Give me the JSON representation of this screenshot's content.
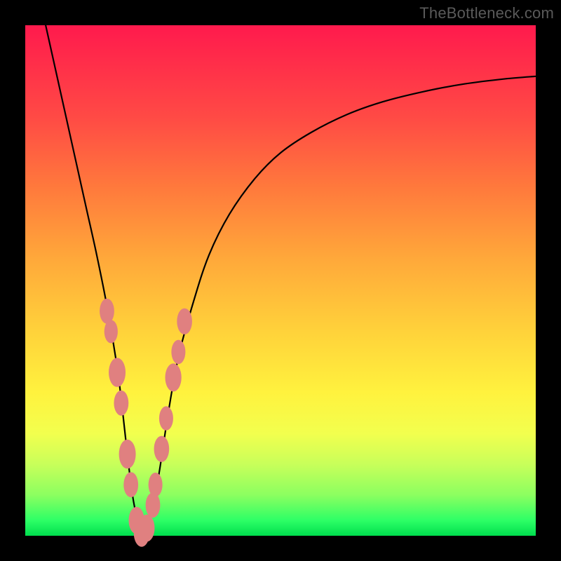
{
  "watermark": "TheBottleneck.com",
  "chart_data": {
    "type": "line",
    "title": "",
    "xlabel": "",
    "ylabel": "",
    "xlim": [
      0,
      100
    ],
    "ylim": [
      0,
      100
    ],
    "grid": false,
    "series": [
      {
        "name": "curve",
        "x": [
          4,
          6,
          8,
          10,
          12,
          14,
          16,
          18,
          19,
          20,
          21,
          22,
          23,
          24,
          26,
          28,
          30,
          33,
          36,
          40,
          45,
          50,
          56,
          63,
          70,
          78,
          86,
          94,
          100
        ],
        "y": [
          100,
          91,
          82,
          73,
          64,
          55,
          45,
          33,
          25,
          16,
          8,
          3,
          0,
          2,
          11,
          24,
          35,
          46,
          55,
          63,
          70,
          75,
          79,
          82.5,
          85,
          87,
          88.5,
          89.5,
          90
        ]
      }
    ],
    "markers": [
      {
        "x": 16.0,
        "y": 44,
        "r": 2.6
      },
      {
        "x": 16.8,
        "y": 40,
        "r": 2.4
      },
      {
        "x": 18.0,
        "y": 32,
        "r": 3.0
      },
      {
        "x": 18.8,
        "y": 26,
        "r": 2.6
      },
      {
        "x": 20.0,
        "y": 16,
        "r": 3.0
      },
      {
        "x": 20.7,
        "y": 10,
        "r": 2.6
      },
      {
        "x": 21.8,
        "y": 3,
        "r": 2.8
      },
      {
        "x": 22.8,
        "y": 0.5,
        "r": 2.8
      },
      {
        "x": 23.8,
        "y": 1.5,
        "r": 2.8
      },
      {
        "x": 25.0,
        "y": 6,
        "r": 2.6
      },
      {
        "x": 25.5,
        "y": 10,
        "r": 2.5
      },
      {
        "x": 26.7,
        "y": 17,
        "r": 2.7
      },
      {
        "x": 27.6,
        "y": 23,
        "r": 2.5
      },
      {
        "x": 29.0,
        "y": 31,
        "r": 2.9
      },
      {
        "x": 30.0,
        "y": 36,
        "r": 2.5
      },
      {
        "x": 31.2,
        "y": 42,
        "r": 2.7
      }
    ],
    "background_gradient": {
      "top": "#ff1a4d",
      "mid": "#fff23e",
      "bottom": "#00de4e"
    }
  }
}
